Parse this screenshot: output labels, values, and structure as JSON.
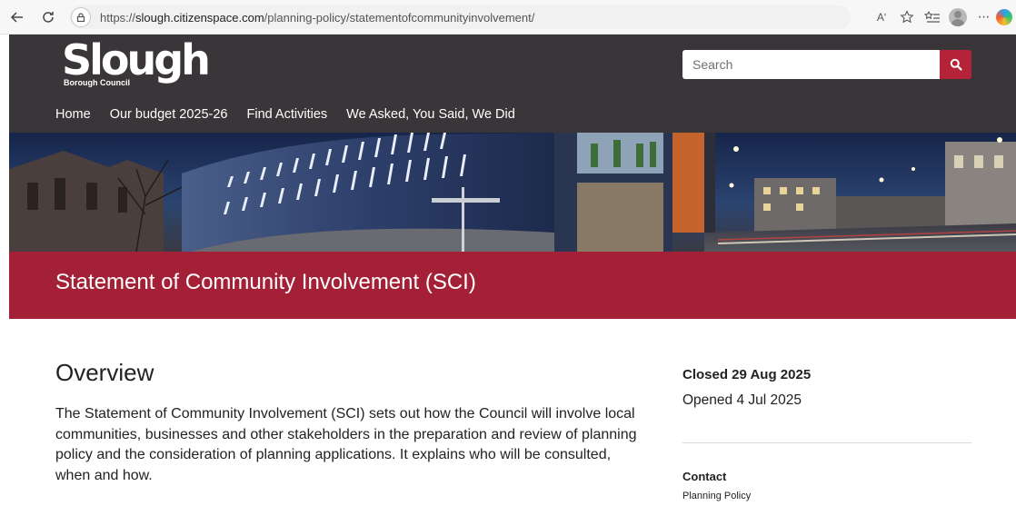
{
  "browser": {
    "url_prefix": "https://",
    "url_host": "slough.citizenspace.com",
    "url_path": "/planning-policy/statementofcommunityinvolvement/",
    "read_aloud_label": "Aʹ",
    "more_label": "···"
  },
  "header": {
    "logo_word": "Slough",
    "logo_sub": "Borough Council",
    "search_placeholder": "Search",
    "nav": [
      {
        "label": "Home"
      },
      {
        "label": "Our budget 2025-26"
      },
      {
        "label": "Find Activities"
      },
      {
        "label": "We Asked, You Said, We Did"
      }
    ]
  },
  "page": {
    "title": "Statement of Community Involvement (SCI)",
    "overview_heading": "Overview",
    "overview_text": "The Statement of Community Involvement (SCI) sets out how the Council will involve local communities, businesses and other stakeholders in the preparation and review of planning policy and the consideration of planning applications. It explains who will be consulted, when and how."
  },
  "sidebar": {
    "closed": "Closed 29 Aug 2025",
    "opened": "Opened 4 Jul 2025",
    "contact_label": "Contact",
    "contact_value": "Planning Policy"
  },
  "colors": {
    "header_bg": "#3a3538",
    "accent_red": "#a32036",
    "search_button": "#b52339"
  }
}
